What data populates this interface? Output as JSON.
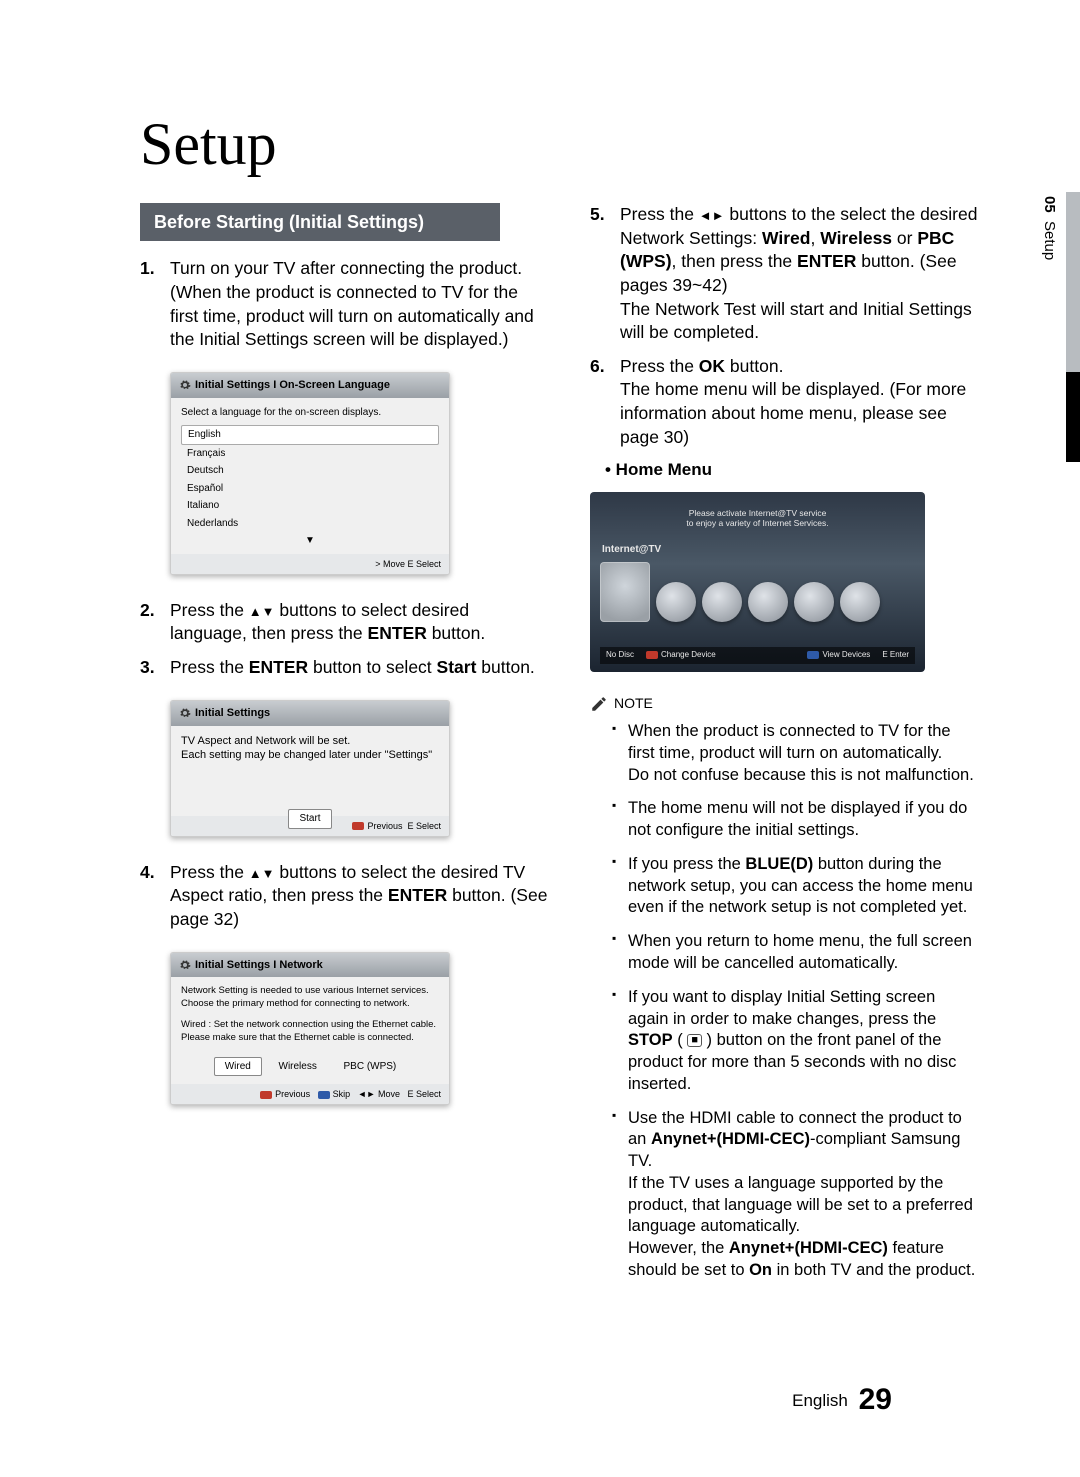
{
  "page_title": "Setup",
  "side_tab": {
    "chapter": "05",
    "name": "Setup"
  },
  "ribbon": "Before Starting (Initial Settings)",
  "steps_left": [
    {
      "n": "1.",
      "html": "Turn on your TV after connecting the product. (When the product is connected to TV for the first time, product will turn on automatically and the Initial Settings screen will be displayed.)"
    },
    {
      "n": "2.",
      "html": "Press the <span class='tri'>▲▼</span> buttons to select desired language, then press the <b>ENTER</b> button."
    },
    {
      "n": "3.",
      "html": "Press the <b>ENTER</b> button to select <b>Start</b> button."
    },
    {
      "n": "4.",
      "html": "Press the <span class='tri'>▲▼</span> buttons to select the desired TV Aspect ratio, then press the <b>ENTER</b> button. (See page 32)"
    }
  ],
  "steps_right": [
    {
      "n": "5.",
      "html": "Press the <span class='tri'>◄►</span> buttons to the select the desired Network Settings: <b>Wired</b>, <b>Wireless</b> or <b>PBC (WPS)</b>, then press the <b>ENTER</b> button. (See pages 39~42)<br>The Network Test will start and Initial Settings will be completed."
    },
    {
      "n": "6.",
      "html": "Press the <b>OK</b> button.<br>The home menu will be displayed. (For more information about home menu, please see page 30)"
    }
  ],
  "dialog_lang": {
    "title": "Initial Settings I On-Screen Language",
    "caption": "Select a language for the on-screen displays.",
    "items": [
      "English",
      "Français",
      "Deutsch",
      "Español",
      "Italiano",
      "Nederlands"
    ],
    "footer": "> Move    E Select"
  },
  "dialog_initial": {
    "title": "Initial Settings",
    "line1": "TV Aspect and Network will be set.",
    "line2": "Each setting may be changed later under \"Settings\"",
    "button": "Start",
    "footer_prev": "Previous",
    "footer_select": "Select"
  },
  "dialog_network": {
    "title": "Initial Settings I Network",
    "line1": "Network Setting is needed to use various Internet services.",
    "line2": "Choose the primary method for connecting to network.",
    "line3": "Wired : Set the network connection using the Ethernet cable.",
    "line4": "Please make sure that the Ethernet cable is connected.",
    "buttons": [
      "Wired",
      "Wireless",
      "PBC (WPS)"
    ],
    "footer_prev": "Previous",
    "footer_skip": "Skip",
    "footer_move": "Move",
    "footer_select": "Select"
  },
  "home_menu_label": "• Home Menu",
  "home_figure": {
    "banner1": "Please activate Internet@TV service",
    "banner2": "to enjoy a variety of Internet Services.",
    "internet": "Internet@TV",
    "foot_nodisc": "No Disc",
    "foot_change": "Change Device",
    "foot_view": "View Devices",
    "foot_enter": "Enter"
  },
  "note_label": "NOTE",
  "notes": [
    "When the product is connected to TV for the first time, product will turn on automatically.<br>Do not confuse because this is not malfunction.",
    "The home menu will not be displayed if you do not configure the initial settings.",
    "If you press the <b>BLUE(D)</b> button during the network setup, you can access the home menu even if the network setup is not completed yet.",
    "When you return to home menu, the full screen mode will be cancelled automatically.",
    "If you want to display Initial Setting screen again in order to make changes, press the <b>STOP</b> ( <span class='stop-icon'>■</span> ) button on the front panel of the product for more than 5 seconds with no disc inserted.",
    "Use the HDMI cable to connect the product to an <b>Anynet+(HDMI-CEC)</b>-compliant Samsung TV.<br>If the TV uses a language supported by the product, that language will be set to a preferred language automatically.<br>However, the <b>Anynet+(HDMI-CEC)</b> feature should be set to <b>On</b> in both TV and the product."
  ],
  "footer": {
    "lang": "English",
    "page": "29"
  }
}
